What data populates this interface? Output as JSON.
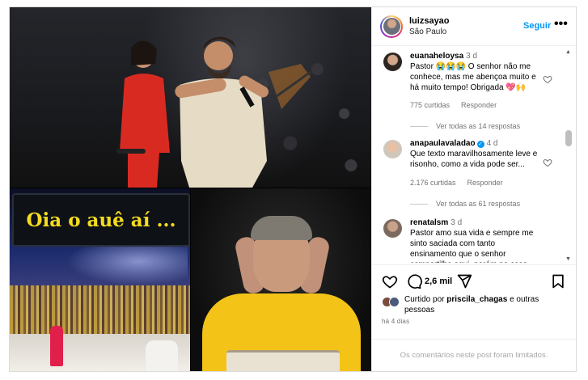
{
  "post": {
    "username": "luizsayao",
    "location": "São Paulo",
    "follow_label": "Seguir",
    "more_label": "•••",
    "media_caption": "Oia o auê aí ...",
    "likes_count": "2,6 mil",
    "liked_by": {
      "prefix": "Curtido por",
      "user": "priscila_chagas",
      "suffix": "e outras pessoas"
    },
    "date": "há 4 dias",
    "comments_limited": "Os comentários neste post foram limitados."
  },
  "comments": [
    {
      "user": "euanaheloysa",
      "time": "3 d",
      "text": "Pastor 😭😭😭 O senhor não me conhece, mas me abençoa muito e há muito tempo! Obrigada 💖🙌",
      "likes": "775 curtidas",
      "reply": "Responder",
      "view_replies": "Ver todas as 14 respostas"
    },
    {
      "user": "anapaulavaladao",
      "verified": true,
      "time": "4 d",
      "text": "Que texto maravilhosamente leve e risonho, como a vida pode ser...",
      "likes": "2.176 curtidas",
      "reply": "Responder",
      "view_replies": "Ver todas as 61 respostas"
    },
    {
      "user": "renatalsm",
      "time": "3 d",
      "text": "Pastor amo sua vida e sempre me sinto saciada com tanto ensinamento que o senhor compartilha aqui, porém no caso"
    }
  ],
  "icons": {
    "like": "heart-icon",
    "comment": "comment-bubble-icon",
    "share": "paper-plane-icon",
    "save": "bookmark-icon"
  },
  "colors": {
    "link": "#0095f6",
    "muted": "#737373",
    "banner_text": "#f5dc1e"
  }
}
